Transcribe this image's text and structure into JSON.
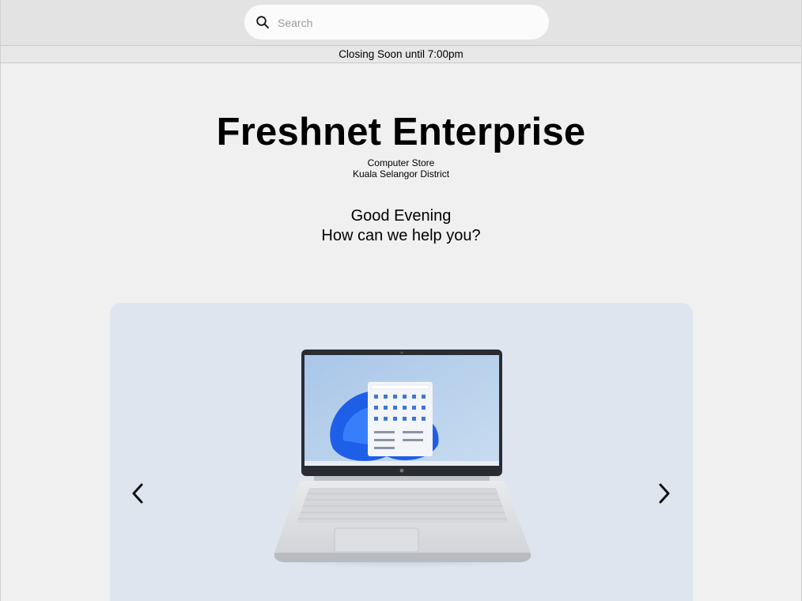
{
  "search": {
    "placeholder": "Search",
    "icon": "search-icon"
  },
  "status_banner": {
    "text": "Closing Soon until 7:00pm"
  },
  "store": {
    "name": "Freshnet Enterprise",
    "category": "Computer Store",
    "location": "Kuala Selangor District"
  },
  "greeting": {
    "line1": "Good Evening",
    "line2": "How can we help you?"
  },
  "carousel": {
    "image": "laptop-product-image",
    "prev_icon": "chevron-left-icon",
    "next_icon": "chevron-right-icon"
  },
  "colors": {
    "page_background": "#f0f0f0",
    "topbar_background": "#e3e3e3",
    "carousel_background": "#dfe5ee",
    "accent_blue": "#1f5fe8"
  }
}
